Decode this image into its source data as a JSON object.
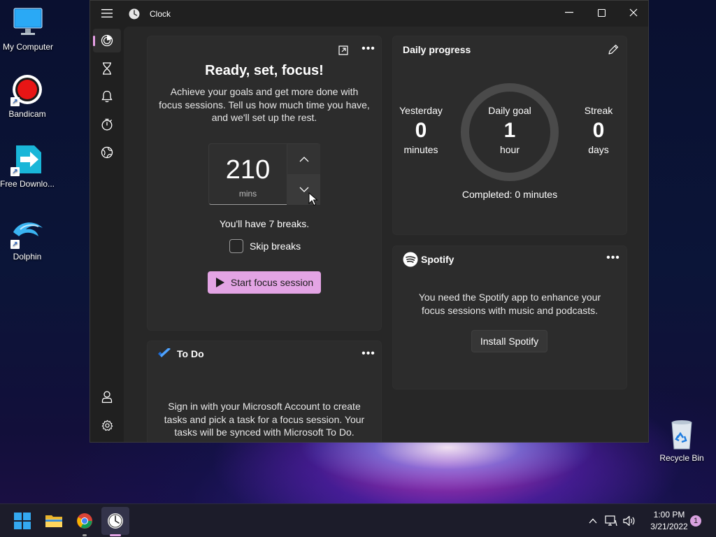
{
  "desktop": {
    "icons": [
      {
        "label": "My Computer"
      },
      {
        "label": "Bandicam"
      },
      {
        "label": "Free Downlo..."
      },
      {
        "label": "Dolphin"
      },
      {
        "label": "Recycle Bin"
      }
    ]
  },
  "window": {
    "title": "Clock",
    "sidebar": {
      "items": [
        {
          "name": "focus-sessions",
          "icon": "focus-icon",
          "active": true
        },
        {
          "name": "timer",
          "icon": "hourglass-icon"
        },
        {
          "name": "alarm",
          "icon": "bell-icon"
        },
        {
          "name": "stopwatch",
          "icon": "stopwatch-icon"
        },
        {
          "name": "world-clock",
          "icon": "globe-icon"
        }
      ],
      "bottom": [
        {
          "name": "account",
          "icon": "person-icon"
        },
        {
          "name": "settings",
          "icon": "gear-icon"
        }
      ]
    }
  },
  "focus": {
    "heading": "Ready, set, focus!",
    "description_lines": [
      "Achieve your goals and get more done with",
      "focus sessions. Tell us how much time you have,",
      "and we'll set up the rest."
    ],
    "minutes_value": "210",
    "minutes_unit": "mins",
    "breaks_text": "You'll have 7 breaks.",
    "skip_breaks_label": "Skip breaks",
    "skip_breaks_checked": false,
    "start_button": "Start focus session"
  },
  "daily_progress": {
    "title": "Daily progress",
    "yesterday": {
      "label": "Yesterday",
      "value": "0",
      "unit": "minutes"
    },
    "goal": {
      "label": "Daily goal",
      "value": "1",
      "unit": "hour"
    },
    "streak": {
      "label": "Streak",
      "value": "0",
      "unit": "days"
    },
    "completed": "Completed: 0 minutes",
    "progress_fraction": 0
  },
  "spotify": {
    "brand": "Spotify",
    "message_lines": [
      "You need the Spotify app to enhance your",
      "focus sessions with music and podcasts."
    ],
    "install_button": "Install Spotify"
  },
  "todo": {
    "title": "To Do",
    "message_lines": [
      "Sign in with your Microsoft Account to create",
      "tasks and pick a task for a focus session. Your",
      "tasks will be synced with Microsoft To Do."
    ]
  },
  "taskbar": {
    "apps": [
      {
        "name": "start",
        "icon": "windows-icon"
      },
      {
        "name": "file-explorer",
        "icon": "folder-icon"
      },
      {
        "name": "chrome",
        "icon": "chrome-icon"
      },
      {
        "name": "clock",
        "icon": "clock-app-icon"
      }
    ],
    "time": "1:00 PM",
    "date": "3/21/2022",
    "notification_count": "1"
  },
  "colors": {
    "accent": "#e3a4e4",
    "window_bg": "#202020",
    "card_bg": "#2c2c2c"
  }
}
